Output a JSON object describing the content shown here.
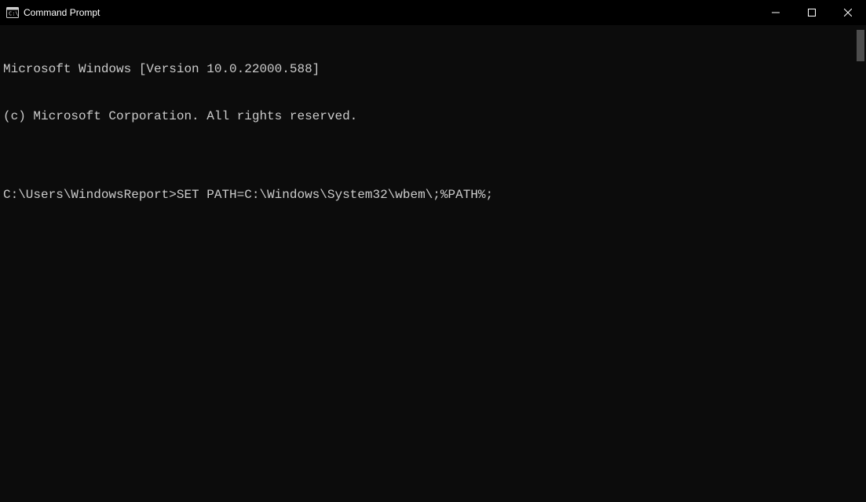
{
  "window": {
    "title": "Command Prompt",
    "icon_name": "cmd-icon"
  },
  "terminal": {
    "lines": [
      "Microsoft Windows [Version 10.0.22000.588]",
      "(c) Microsoft Corporation. All rights reserved.",
      ""
    ],
    "prompt": "C:\\Users\\WindowsReport>",
    "command": "SET PATH=C:\\Windows\\System32\\wbem\\;%PATH%;"
  }
}
